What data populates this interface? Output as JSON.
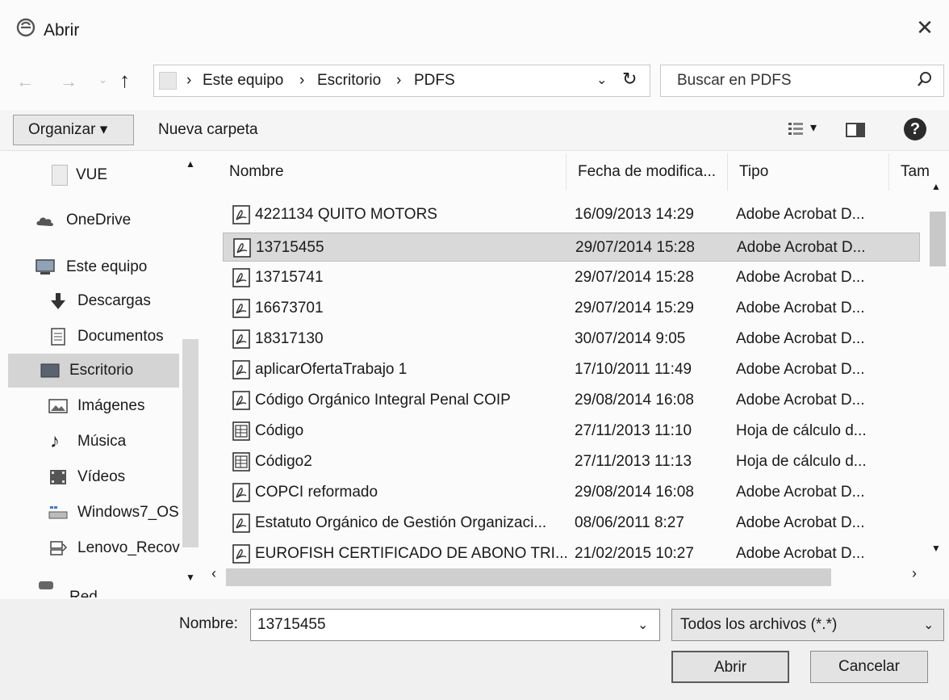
{
  "window": {
    "title": "Abrir",
    "close_glyph": "✕"
  },
  "nav": {
    "back": "←",
    "forward": "→",
    "dropdown": "⌄",
    "up": "↑"
  },
  "address": {
    "crumbs": [
      "Este equipo",
      "Escritorio",
      "PDFS"
    ],
    "separator": "›",
    "dropdown": "⌄",
    "refresh": "↻"
  },
  "search": {
    "placeholder": "Buscar en PDFS"
  },
  "toolbar": {
    "organize_label": "Organizar ▾",
    "new_folder_label": "Nueva carpeta",
    "view_caret": "▾",
    "help": "?"
  },
  "sidebar": {
    "items": [
      {
        "label": "VUE",
        "icon": "folder-icon"
      },
      {
        "label": "OneDrive",
        "icon": "cloud-icon"
      },
      {
        "label": "Este equipo",
        "icon": "computer-icon"
      },
      {
        "label": "Descargas",
        "icon": "download-icon"
      },
      {
        "label": "Documentos",
        "icon": "document-icon"
      },
      {
        "label": "Escritorio",
        "icon": "desktop-icon",
        "selected": true
      },
      {
        "label": "Imágenes",
        "icon": "pictures-icon"
      },
      {
        "label": "Música",
        "icon": "music-icon"
      },
      {
        "label": "Vídeos",
        "icon": "videos-icon"
      },
      {
        "label": "Windows7_OS",
        "icon": "drive-icon"
      },
      {
        "label": "Lenovo_Recov",
        "icon": "recovery-drive-icon"
      }
    ],
    "next_partial": "Red",
    "scroll_up": "▲",
    "scroll_down": "▼"
  },
  "list": {
    "columns": [
      "Nombre",
      "Fecha de modifica...",
      "Tipo",
      "Tam"
    ],
    "sort_arrow": "^",
    "rows": [
      {
        "name": "4221134 QUITO MOTORS",
        "date": "16/09/2013 14:29",
        "type": "Adobe Acrobat D...",
        "icon": "pdf-icon"
      },
      {
        "name": "13715455",
        "date": "29/07/2014 15:28",
        "type": "Adobe Acrobat D...",
        "icon": "pdf-icon",
        "selected": true
      },
      {
        "name": "13715741",
        "date": "29/07/2014 15:28",
        "type": "Adobe Acrobat D...",
        "icon": "pdf-icon"
      },
      {
        "name": "16673701",
        "date": "29/07/2014 15:29",
        "type": "Adobe Acrobat D...",
        "icon": "pdf-icon"
      },
      {
        "name": "18317130",
        "date": "30/07/2014 9:05",
        "type": "Adobe Acrobat D...",
        "icon": "pdf-icon"
      },
      {
        "name": "aplicarOfertaTrabajo 1",
        "date": "17/10/2011 11:49",
        "type": "Adobe Acrobat D...",
        "icon": "pdf-icon"
      },
      {
        "name": "Código Orgánico Integral Penal COIP",
        "date": "29/08/2014 16:08",
        "type": "Adobe Acrobat D...",
        "icon": "pdf-icon"
      },
      {
        "name": "Código",
        "date": "27/11/2013 11:10",
        "type": "Hoja de cálculo d...",
        "icon": "spreadsheet-icon"
      },
      {
        "name": "Código2",
        "date": "27/11/2013 11:13",
        "type": "Hoja de cálculo d...",
        "icon": "spreadsheet-icon"
      },
      {
        "name": "COPCI reformado",
        "date": "29/08/2014 16:08",
        "type": "Adobe Acrobat D...",
        "icon": "pdf-icon"
      },
      {
        "name": "Estatuto Orgánico de Gestión Organizaci...",
        "date": "08/06/2011 8:27",
        "type": "Adobe Acrobat D...",
        "icon": "pdf-icon"
      },
      {
        "name": "EUROFISH CERTIFICADO DE ABONO TRI...",
        "date": "21/02/2015 10:27",
        "type": "Adobe Acrobat D...",
        "icon": "pdf-icon"
      }
    ],
    "scroll_up": "▲",
    "scroll_down": "▼",
    "scroll_left": "‹",
    "scroll_right": "›"
  },
  "footer": {
    "name_label": "Nombre:",
    "name_value": "13715455",
    "name_dropdown": "⌄",
    "file_type": "Todos los archivos (*.*)",
    "type_dropdown": "⌄",
    "open_label": "Abrir",
    "cancel_label": "Cancelar"
  }
}
